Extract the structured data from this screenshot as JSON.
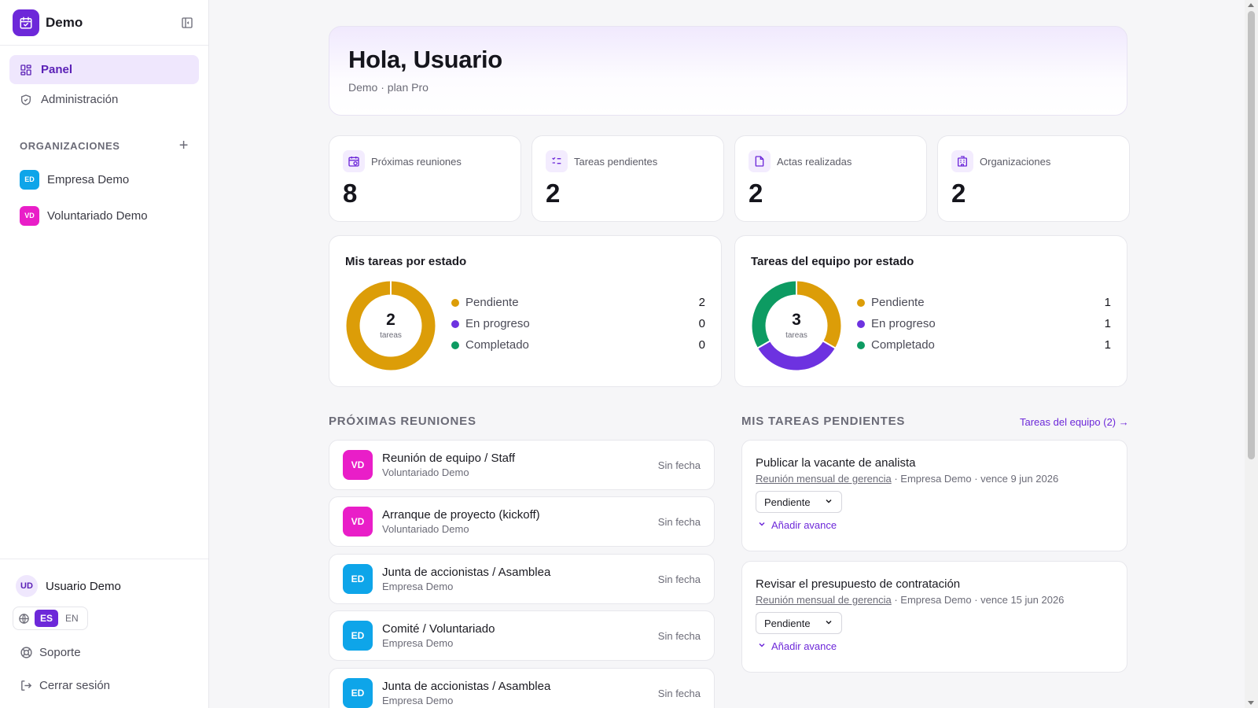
{
  "app": {
    "name": "Demo"
  },
  "nav": {
    "panel": "Panel",
    "admin": "Administración"
  },
  "orgs": {
    "heading": "ORGANIZACIONES",
    "items": [
      {
        "initials": "ED",
        "name": "Empresa Demo",
        "color": "#0ea5e9"
      },
      {
        "initials": "VD",
        "name": "Voluntariado Demo",
        "color": "#e91ec8"
      }
    ]
  },
  "footer": {
    "user_initials": "UD",
    "user_name": "Usuario Demo",
    "lang_es": "ES",
    "lang_en": "EN",
    "support": "Soporte",
    "logout": "Cerrar sesión"
  },
  "hero": {
    "title": "Hola, Usuario",
    "subtitle": "Demo · plan Pro"
  },
  "stats": [
    {
      "label": "Próximas reuniones",
      "value": "8",
      "icon": "calendar-icon"
    },
    {
      "label": "Tareas pendientes",
      "value": "2",
      "icon": "checklist-icon"
    },
    {
      "label": "Actas realizadas",
      "value": "2",
      "icon": "document-icon"
    },
    {
      "label": "Organizaciones",
      "value": "2",
      "icon": "building-icon"
    }
  ],
  "colors": {
    "pending": "#dc9d08",
    "progress": "#6d32e0",
    "done": "#0d9b62",
    "accent": "#6d28d9"
  },
  "my_tasks_chart": {
    "title": "Mis tareas por estado",
    "total": "2",
    "total_label": "tareas",
    "legend": [
      {
        "label": "Pendiente",
        "value": "2"
      },
      {
        "label": "En progreso",
        "value": "0"
      },
      {
        "label": "Completado",
        "value": "0"
      }
    ]
  },
  "team_tasks_chart": {
    "title": "Tareas del equipo por estado",
    "total": "3",
    "total_label": "tareas",
    "legend": [
      {
        "label": "Pendiente",
        "value": "1"
      },
      {
        "label": "En progreso",
        "value": "1"
      },
      {
        "label": "Completado",
        "value": "1"
      }
    ]
  },
  "meetings": {
    "heading": "PRÓXIMAS REUNIONES",
    "items": [
      {
        "initials": "VD",
        "title": "Reunión de equipo / Staff",
        "org": "Voluntariado Demo",
        "date": "Sin fecha",
        "color": "#e91ec8"
      },
      {
        "initials": "VD",
        "title": "Arranque de proyecto (kickoff)",
        "org": "Voluntariado Demo",
        "date": "Sin fecha",
        "color": "#e91ec8"
      },
      {
        "initials": "ED",
        "title": "Junta de accionistas / Asamblea",
        "org": "Empresa Demo",
        "date": "Sin fecha",
        "color": "#0ea5e9"
      },
      {
        "initials": "ED",
        "title": "Comité / Voluntariado",
        "org": "Empresa Demo",
        "date": "Sin fecha",
        "color": "#0ea5e9"
      },
      {
        "initials": "ED",
        "title": "Junta de accionistas / Asamblea",
        "org": "Empresa Demo",
        "date": "Sin fecha",
        "color": "#0ea5e9"
      }
    ]
  },
  "pending_tasks": {
    "heading": "MIS TAREAS PENDIENTES",
    "team_link": "Tareas del equipo (2) →",
    "items": [
      {
        "title": "Publicar la vacante de analista",
        "meeting": "Reunión mensual de gerencia",
        "meta": " · Empresa Demo · vence 9 jun 2026",
        "status": "Pendiente",
        "add": "Añadir avance"
      },
      {
        "title": "Revisar el presupuesto de contratación",
        "meeting": "Reunión mensual de gerencia",
        "meta": " · Empresa Demo · vence 15 jun 2026",
        "status": "Pendiente",
        "add": "Añadir avance"
      }
    ]
  }
}
